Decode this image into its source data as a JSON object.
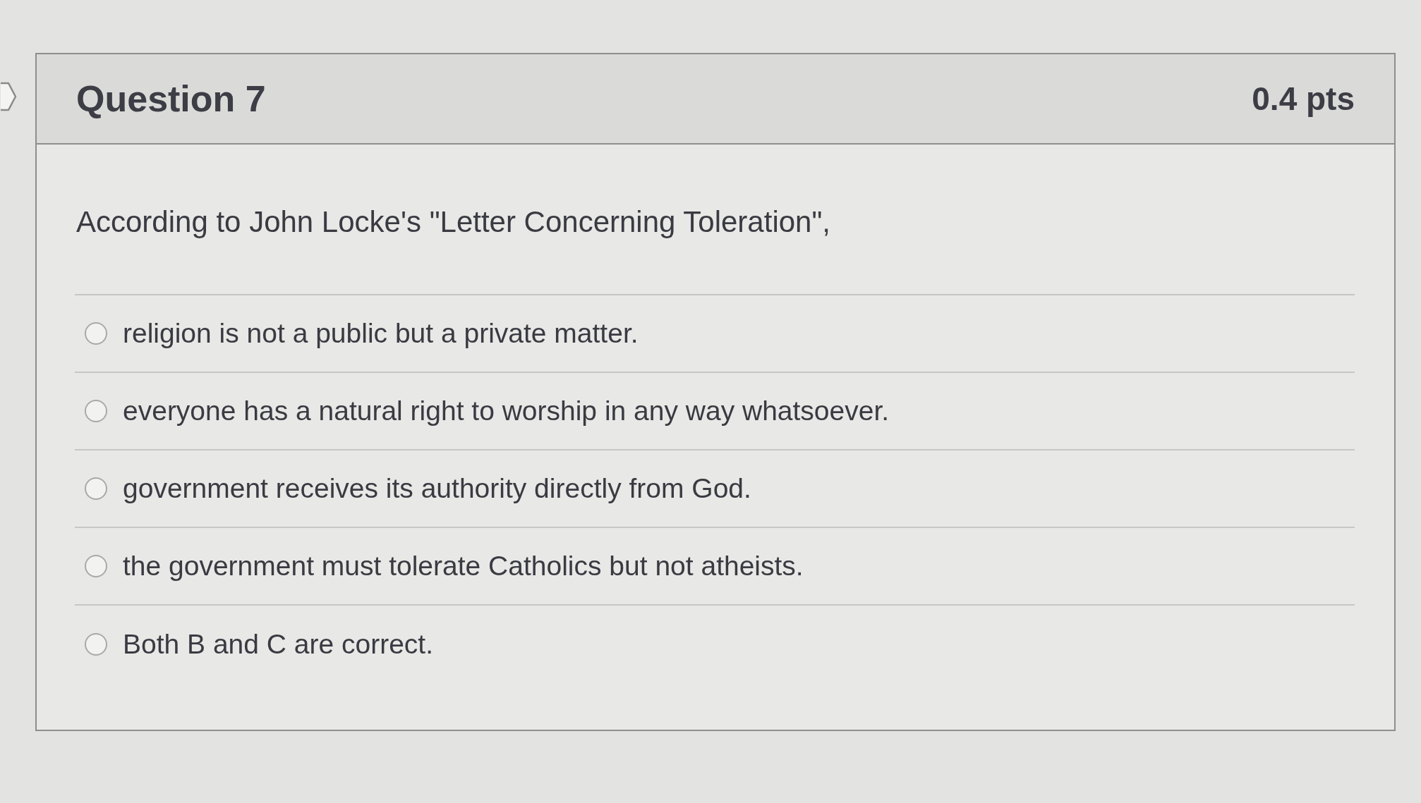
{
  "question": {
    "title": "Question 7",
    "points": "0.4 pts",
    "prompt": "According to John Locke's \"Letter Concerning Toleration\",",
    "options": [
      {
        "text": "religion is not a public but a private matter.",
        "selected": false
      },
      {
        "text": "everyone has a natural right to worship in any way whatsoever.",
        "selected": false
      },
      {
        "text": "government receives its authority directly from God.",
        "selected": false
      },
      {
        "text": "the government must tolerate Catholics but not atheists.",
        "selected": false
      },
      {
        "text": "Both B and C are correct.",
        "selected": false
      }
    ]
  }
}
